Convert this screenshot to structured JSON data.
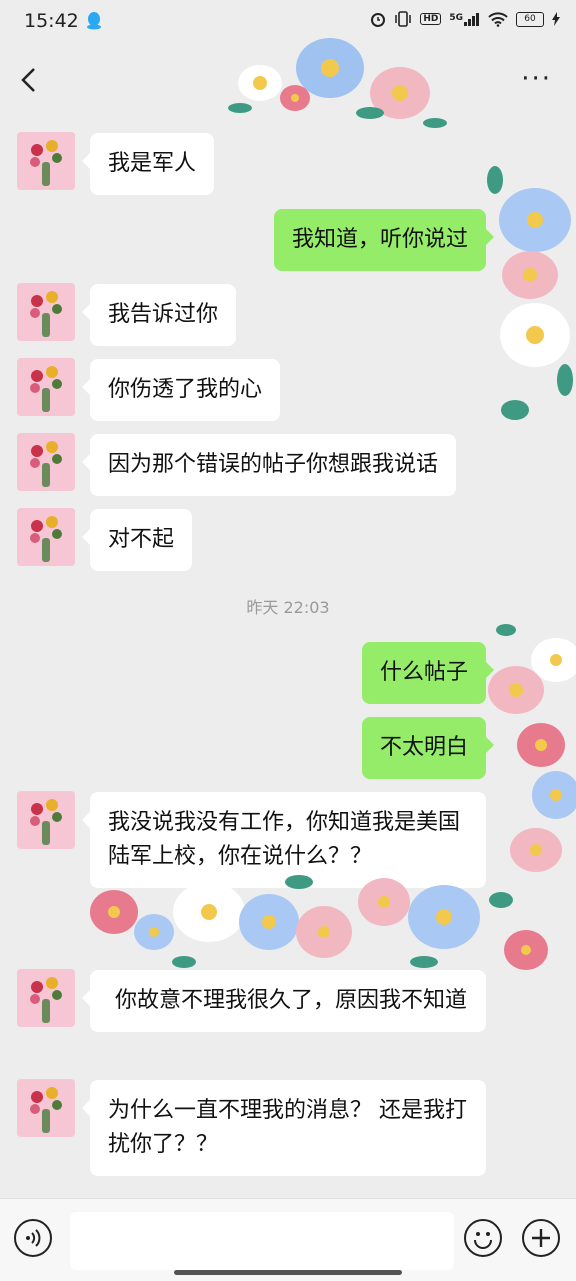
{
  "status_bar": {
    "time": "15:42",
    "hd": "HD",
    "net": "5G",
    "battery": "60"
  },
  "chat": {
    "messages": [
      {
        "side": "left",
        "text": "我是军人"
      },
      {
        "side": "right",
        "text": "我知道，听你说过"
      },
      {
        "side": "left",
        "text": "我告诉过你"
      },
      {
        "side": "left",
        "text": "你伤透了我的心"
      },
      {
        "side": "left",
        "text": "因为那个错误的帖子你想跟我说话"
      },
      {
        "side": "left",
        "text": "对不起"
      },
      {
        "side": "right",
        "text": "什么帖子"
      },
      {
        "side": "right",
        "text": "不太明白"
      },
      {
        "side": "left",
        "text": "我没说我没有工作，你知道我是美国陆军上校，你在说什么？？"
      },
      {
        "side": "left",
        "text": " 你故意不理我很久了，原因我不知道"
      },
      {
        "side": "left",
        "text": "为什么一直不理我的消息？ 还是我打扰你了？？"
      }
    ],
    "timestamp": "昨天 22:03"
  },
  "colors": {
    "background": "#ededed",
    "sent_bubble": "#95ec69",
    "received_bubble": "#ffffff"
  }
}
